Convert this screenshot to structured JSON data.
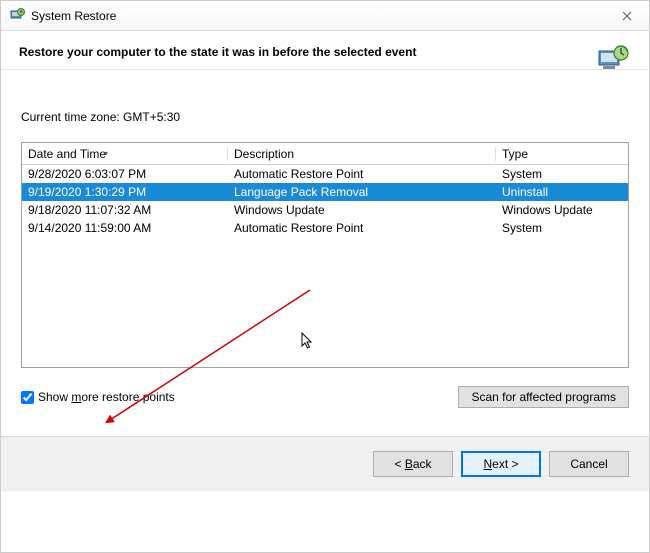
{
  "window": {
    "title": "System Restore"
  },
  "header": {
    "text": "Restore your computer to the state it was in before the selected event"
  },
  "timezone_label": "Current time zone: GMT+5:30",
  "table": {
    "headers": {
      "datetime": "Date and Time",
      "description": "Description",
      "type": "Type"
    },
    "rows": [
      {
        "datetime": "9/28/2020 6:03:07 PM",
        "description": "Automatic Restore Point",
        "type": "System"
      },
      {
        "datetime": "9/19/2020 1:30:29 PM",
        "description": "Language Pack Removal",
        "type": "Uninstall"
      },
      {
        "datetime": "9/18/2020 11:07:32 AM",
        "description": "Windows Update",
        "type": "Windows Update"
      },
      {
        "datetime": "9/14/2020 11:59:00 AM",
        "description": "Automatic Restore Point",
        "type": "System"
      }
    ],
    "selected_index": 1
  },
  "checkbox": {
    "label_before": "Show ",
    "label_underline": "m",
    "label_after": "ore restore points",
    "checked": true
  },
  "buttons": {
    "scan": "Scan for affected programs",
    "back_prefix": "< ",
    "back_u": "B",
    "back_after": "ack",
    "next_u": "N",
    "next_after": "ext >",
    "cancel": "Cancel"
  },
  "colors": {
    "selection": "#1a8ad6",
    "primary_border": "#0078d7"
  }
}
